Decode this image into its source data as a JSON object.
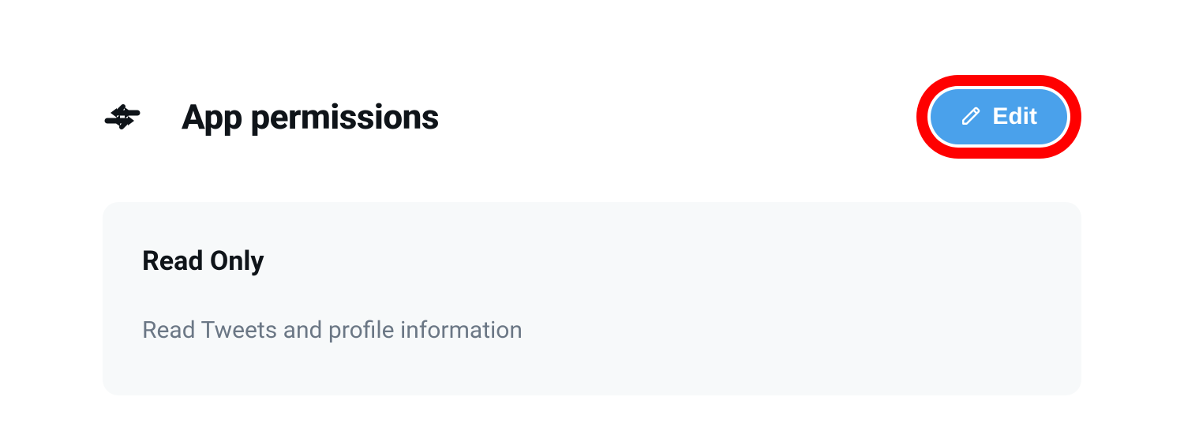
{
  "header": {
    "title": "App permissions",
    "edit_label": "Edit"
  },
  "card": {
    "title": "Read Only",
    "description": "Read Tweets and profile information"
  },
  "colors": {
    "accent": "#4aa1eb",
    "highlight": "#ff0000",
    "card_bg": "#f7f9fa",
    "text_primary": "#0f1419",
    "text_secondary": "#6b7785"
  },
  "icons": {
    "swap": "swap-arrows-icon",
    "edit": "pencil-icon"
  }
}
